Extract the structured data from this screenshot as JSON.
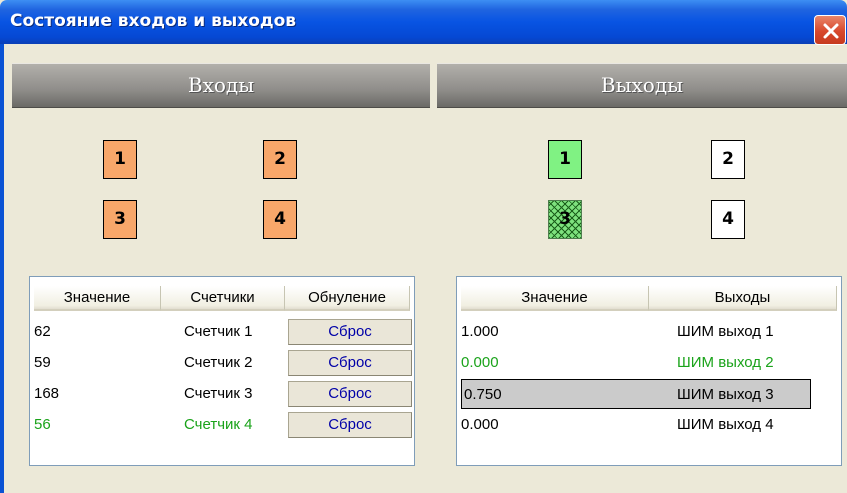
{
  "window": {
    "title": "Состояние входов и выходов"
  },
  "inputs": {
    "header": "Входы",
    "boxes": [
      "1",
      "2",
      "3",
      "4"
    ],
    "table": {
      "columns": [
        "Значение",
        "Счетчики",
        "Обнуление"
      ],
      "rows": [
        {
          "value": "62",
          "counter": "Счетчик 1",
          "reset": "Сброс",
          "highlight": false
        },
        {
          "value": "59",
          "counter": "Счетчик 2",
          "reset": "Сброс",
          "highlight": false
        },
        {
          "value": "168",
          "counter": "Счетчик 3",
          "reset": "Сброс",
          "highlight": false
        },
        {
          "value": "56",
          "counter": "Счетчик 4",
          "reset": "Сброс",
          "highlight": true
        }
      ]
    }
  },
  "outputs": {
    "header": "Выходы",
    "boxes": [
      {
        "label": "1",
        "state": "on"
      },
      {
        "label": "2",
        "state": "off"
      },
      {
        "label": "3",
        "state": "pwm"
      },
      {
        "label": "4",
        "state": "off"
      }
    ],
    "table": {
      "columns": [
        "Значение",
        "Выходы"
      ],
      "rows": [
        {
          "value": "1.000",
          "name": "ШИМ выход 1",
          "highlight": false,
          "selected": false
        },
        {
          "value": "0.000",
          "name": "ШИМ выход 2",
          "highlight": true,
          "selected": false
        },
        {
          "value": "0.750",
          "name": "ШИМ выход 3",
          "highlight": false,
          "selected": true
        },
        {
          "value": "0.000",
          "name": "ШИМ выход 4",
          "highlight": false,
          "selected": false
        }
      ]
    }
  },
  "colors": {
    "input_box": "#f8a76a",
    "output_on": "#80f283",
    "highlight_text": "#1aa31a",
    "link_blue": "#0000a8"
  }
}
